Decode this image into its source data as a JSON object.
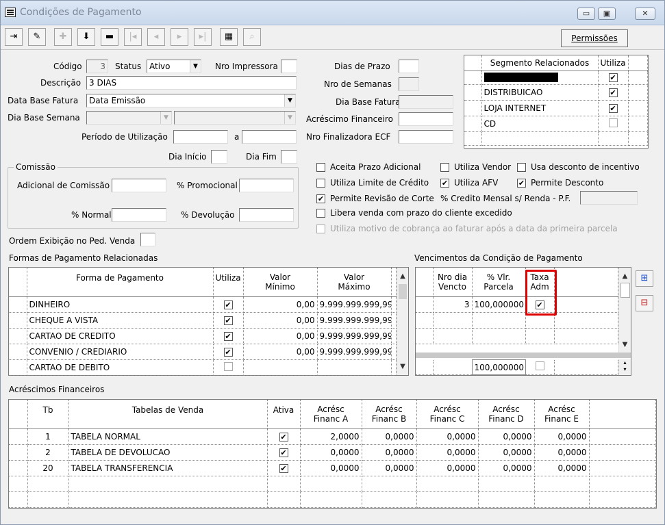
{
  "window": {
    "title": "Condições de Pagamento"
  },
  "toolbar": {
    "permissoes": "Permissões"
  },
  "form": {
    "codigo_label": "Código",
    "codigo_value": "3",
    "status_label": "Status",
    "status_value": "Ativo",
    "nro_impressora_label": "Nro Impressora",
    "descricao_label": "Descrição",
    "descricao_value": "3 DIAS",
    "data_base_fatura_label": "Data Base Fatura",
    "data_base_fatura_value": "Data Emissão",
    "dia_base_semana_label": "Dia Base Semana",
    "periodo_label": "Período de Utilização",
    "periodo_a": "a",
    "dia_inicio_label": "Dia Início",
    "dia_fim_label": "Dia Fim",
    "dias_prazo_label": "Dias de Prazo",
    "nro_semanas_label": "Nro de Semanas",
    "dia_base_fatura_label": "Dia Base Fatura",
    "acrescimo_label": "Acréscimo Financeiro",
    "nro_finalizadora_label": "Nro Finalizadora ECF",
    "ordem_label": "Ordem Exibição no Ped. Venda"
  },
  "comissao": {
    "title": "Comissão",
    "adicional_label": "Adicional de Comissão",
    "promocional_label": "% Promocional",
    "normal_label": "% Normal",
    "devolucao_label": "% Devolução"
  },
  "segmentos": {
    "header_segmento": "Segmento Relacionados",
    "header_utiliza": "Utiliza",
    "rows": [
      {
        "name": "",
        "checked": true,
        "redacted": true
      },
      {
        "name": "DISTRIBUICAO",
        "checked": true
      },
      {
        "name": "LOJA INTERNET",
        "checked": true
      },
      {
        "name": "CD",
        "checked": false
      }
    ]
  },
  "options": {
    "aceita_prazo": {
      "label": "Aceita Prazo Adicional",
      "checked": false
    },
    "utiliza_vendor": {
      "label": "Utiliza Vendor",
      "checked": false
    },
    "usa_desconto": {
      "label": "Usa desconto de incentivo",
      "checked": false
    },
    "utiliza_limite": {
      "label": "Utiliza Limite de Crédito",
      "checked": false
    },
    "utiliza_afv": {
      "label": "Utiliza AFV",
      "checked": true
    },
    "permite_desconto": {
      "label": "Permite Desconto",
      "checked": true
    },
    "permite_revisao": {
      "label": "Permite Revisão de Corte",
      "checked": true
    },
    "credito_mensal_label": "% Credito Mensal s/ Renda - P.F.",
    "libera_venda": {
      "label": "Libera venda com prazo do cliente excedido",
      "checked": false
    },
    "utiliza_motivo": {
      "label": "Utiliza motivo de cobrança ao faturar após a data da primeira parcela",
      "checked": false
    }
  },
  "formas": {
    "section_title": "Formas de Pagamento Relacionadas",
    "headers": {
      "forma": "Forma de Pagamento",
      "utiliza": "Utiliza",
      "vmin_1": "Valor",
      "vmin_2": "Mínimo",
      "vmax_1": "Valor",
      "vmax_2": "Máximo"
    },
    "rows": [
      {
        "forma": "DINHEIRO",
        "checked": true,
        "min": "0,00",
        "max": "9.999.999.999,99"
      },
      {
        "forma": "CHEQUE A VISTA",
        "checked": true,
        "min": "0,00",
        "max": "9.999.999.999,99"
      },
      {
        "forma": "CARTAO DE CREDITO",
        "checked": true,
        "min": "0,00",
        "max": "9.999.999.999,99"
      },
      {
        "forma": "CONVENIO / CREDIARIO",
        "checked": true,
        "min": "0,00",
        "max": "9.999.999.999,99"
      },
      {
        "forma": "CARTAO DE DEBITO",
        "checked": false,
        "min": "",
        "max": ""
      }
    ]
  },
  "vencimentos": {
    "section_title": "Vencimentos da Condição de Pagamento",
    "headers": {
      "nro_1": "Nro dia",
      "nro_2": "Vencto",
      "vlr_1": "% Vlr.",
      "vlr_2": "Parcela",
      "taxa_1": "Taxa",
      "taxa_2": "Adm"
    },
    "rows": [
      {
        "nro": "3",
        "vlr": "100,000000",
        "taxa": true
      }
    ],
    "total": "100,000000"
  },
  "acrescimos": {
    "section_title": "Acréscimos Financeiros",
    "headers": {
      "tb": "Tb",
      "tabela": "Tabelas de Venda",
      "ativa": "Ativa",
      "a1": "Acrésc",
      "a2": "Financ A",
      "b1": "Acrésc",
      "b2": "Financ B",
      "c1": "Acrésc",
      "c2": "Financ C",
      "d1": "Acrésc",
      "d2": "Financ D",
      "e1": "Acrésc",
      "e2": "Financ E"
    },
    "rows": [
      {
        "tb": "1",
        "tabela": "TABELA NORMAL",
        "ativa": true,
        "a": "2,0000",
        "b": "0,0000",
        "c": "0,0000",
        "d": "0,0000",
        "e": "0,0000"
      },
      {
        "tb": "2",
        "tabela": "TABELA DE DEVOLUCAO",
        "ativa": true,
        "a": "0,0000",
        "b": "0,0000",
        "c": "0,0000",
        "d": "0,0000",
        "e": "0,0000"
      },
      {
        "tb": "20",
        "tabela": "TABELA TRANSFERENCIA",
        "ativa": true,
        "a": "0,0000",
        "b": "0,0000",
        "c": "0,0000",
        "d": "0,0000",
        "e": "0,0000"
      }
    ]
  },
  "colors": {
    "highlight": "#e00000",
    "title_text": "#7b8796"
  }
}
